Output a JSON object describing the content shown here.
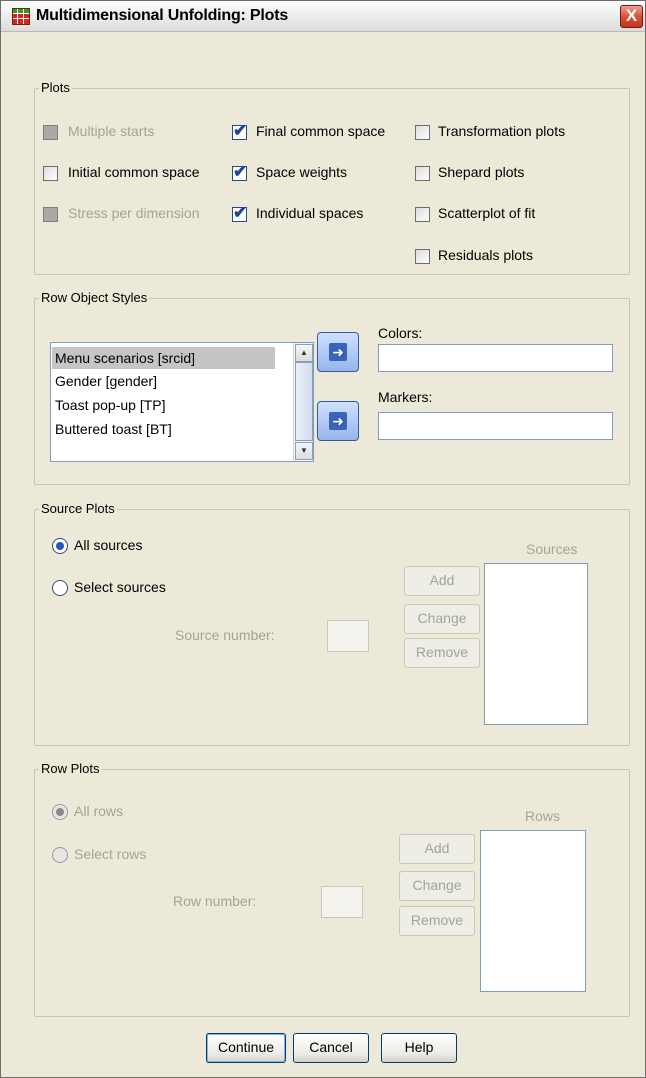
{
  "window": {
    "title": "Multidimensional Unfolding: Plots",
    "close_label": "X"
  },
  "plots": {
    "legend": "Plots",
    "multiple_starts": "Multiple starts",
    "initial_common_space": "Initial common space",
    "stress_per_dimension": "Stress per dimension",
    "final_common_space": "Final common space",
    "space_weights": "Space weights",
    "individual_spaces": "Individual spaces",
    "transformation_plots": "Transformation plots",
    "shepard_plots": "Shepard plots",
    "scatterplot_of_fit": "Scatterplot of fit",
    "residuals_plots": "Residuals plots"
  },
  "row_object_styles": {
    "legend": "Row Object Styles",
    "items": [
      "Menu scenarios [srcid]",
      "Gender [gender]",
      "Toast pop-up [TP]",
      "Buttered toast [BT]"
    ],
    "colors_label": "Colors:",
    "markers_label": "Markers:"
  },
  "source_plots": {
    "legend": "Source Plots",
    "all_sources": "All sources",
    "select_sources": "Select sources",
    "source_number": "Source number:",
    "sources_header": "Sources",
    "add": "Add",
    "change": "Change",
    "remove": "Remove"
  },
  "row_plots": {
    "legend": "Row Plots",
    "all_rows": "All rows",
    "select_rows": "Select rows",
    "row_number": "Row number:",
    "rows_header": "Rows",
    "add": "Add",
    "change": "Change",
    "remove": "Remove"
  },
  "buttons": {
    "continue": "Continue",
    "cancel": "Cancel",
    "help": "Help"
  }
}
